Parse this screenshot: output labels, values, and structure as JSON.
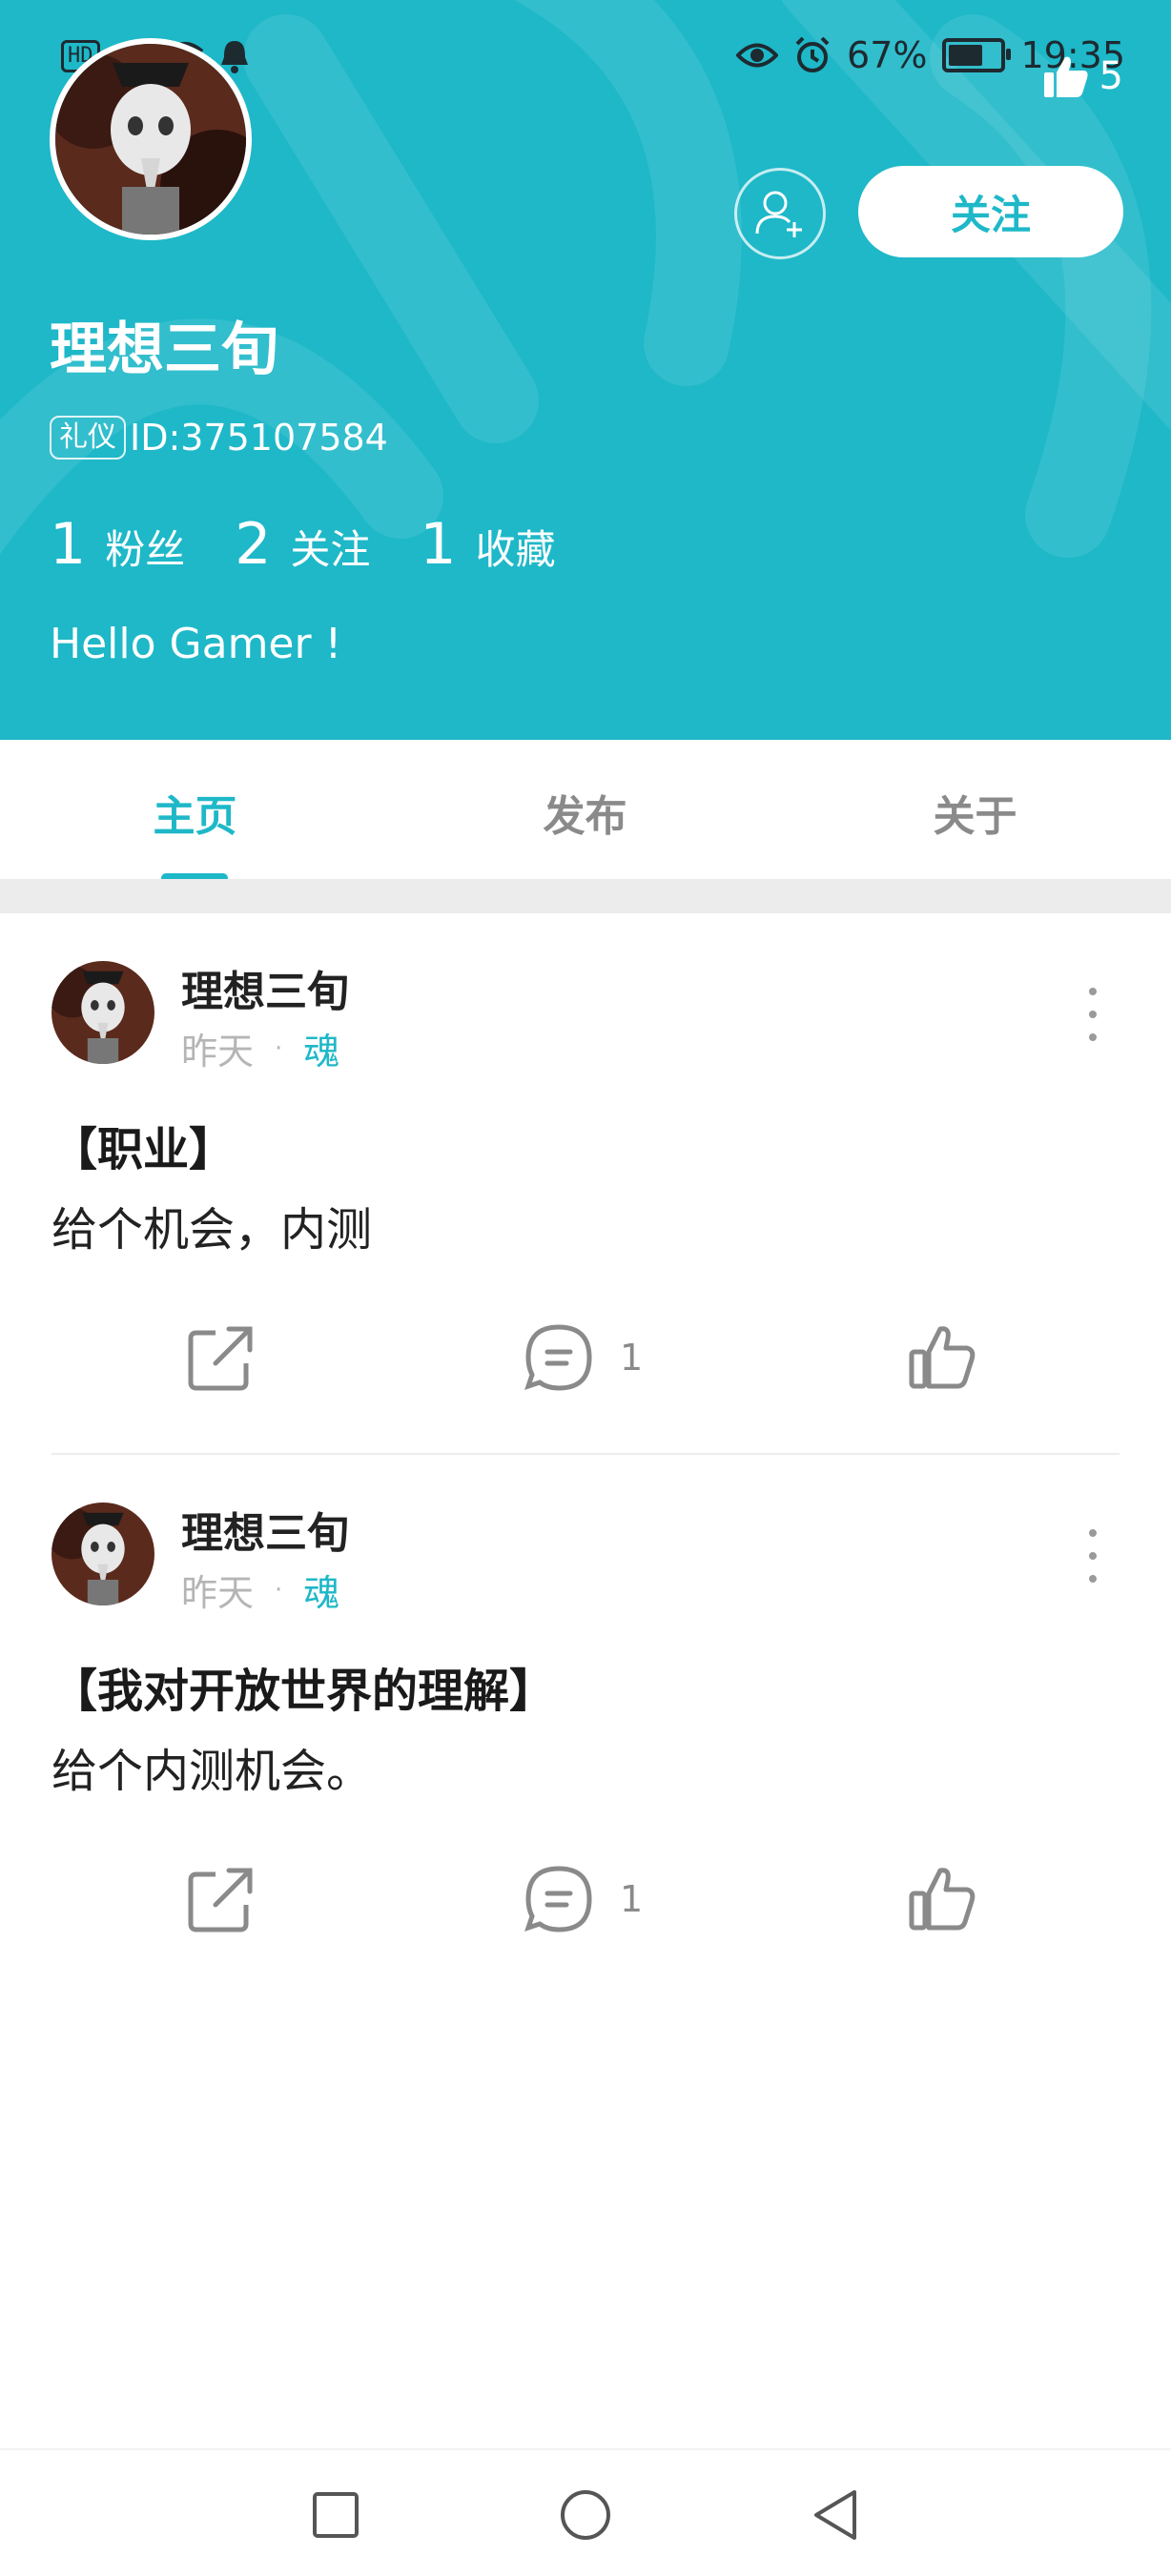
{
  "status_bar": {
    "left_label": "HD",
    "battery": "67%",
    "battery_level": 0.67,
    "time": "19:35"
  },
  "header": {
    "like_count": "5",
    "follow_label": "关注",
    "username": "理想三旬",
    "badge": "礼仪",
    "user_id": "ID:375107584",
    "stats": [
      {
        "num": "1",
        "label": "粉丝"
      },
      {
        "num": "2",
        "label": "关注"
      },
      {
        "num": "1",
        "label": "收藏"
      }
    ],
    "bio": "Hello Gamer !",
    "colors": {
      "accent": "#1eb8c8",
      "text_on_accent": "#ffffff"
    }
  },
  "tabs": [
    {
      "label": "主页",
      "active": true
    },
    {
      "label": "发布",
      "active": false
    },
    {
      "label": "关于",
      "active": false
    }
  ],
  "posts": [
    {
      "author": "理想三旬",
      "time": "昨天",
      "separator": "·",
      "tag": "魂",
      "title": "【职业】",
      "body": "给个机会，内测",
      "comment_count": "1"
    },
    {
      "author": "理想三旬",
      "time": "昨天",
      "separator": "·",
      "tag": "魂",
      "title": "【我对开放世界的理解】",
      "body": "给个内测机会。",
      "comment_count": "1"
    }
  ],
  "icons": {
    "status": [
      "wifi-icon",
      "signal-icon",
      "notification-bell-icon",
      "eye-icon",
      "alarm-icon",
      "battery-icon"
    ],
    "header": [
      "thumbs-up-icon",
      "add-friend-icon"
    ],
    "post_actions": [
      "share-icon",
      "comment-icon",
      "like-icon"
    ],
    "nav": [
      "recent-apps-icon",
      "home-icon",
      "back-icon"
    ]
  }
}
